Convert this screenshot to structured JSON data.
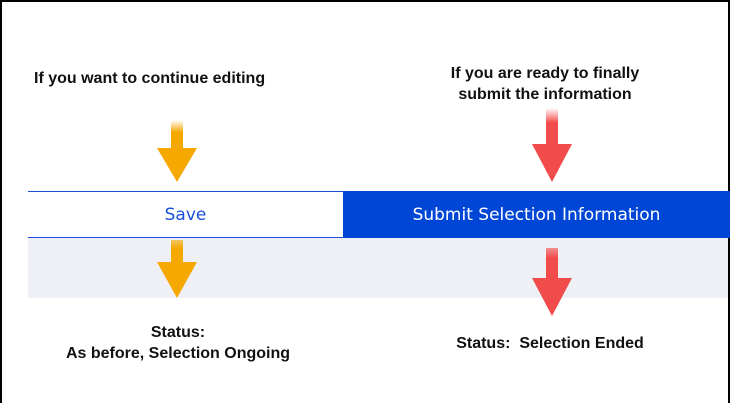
{
  "captions": {
    "save_intent": "If you want to continue editing",
    "submit_intent_line1": "If you are ready to finally",
    "submit_intent_line2": "submit the information",
    "save_status_line1": "Status:",
    "save_status_line2": "As before, Selection Ongoing",
    "submit_status": "Status:  Selection Ended"
  },
  "toolbar": {
    "save_label": "Save",
    "submit_label": "Submit Selection Information"
  },
  "colors": {
    "save_arrow": "#f5a800",
    "submit_arrow": "#f24b4b",
    "primary_blue": "#0046d6",
    "gray_band": "#eef0f5"
  },
  "icons": {
    "save_arrow": "arrow-down-icon",
    "submit_arrow": "arrow-down-icon"
  }
}
